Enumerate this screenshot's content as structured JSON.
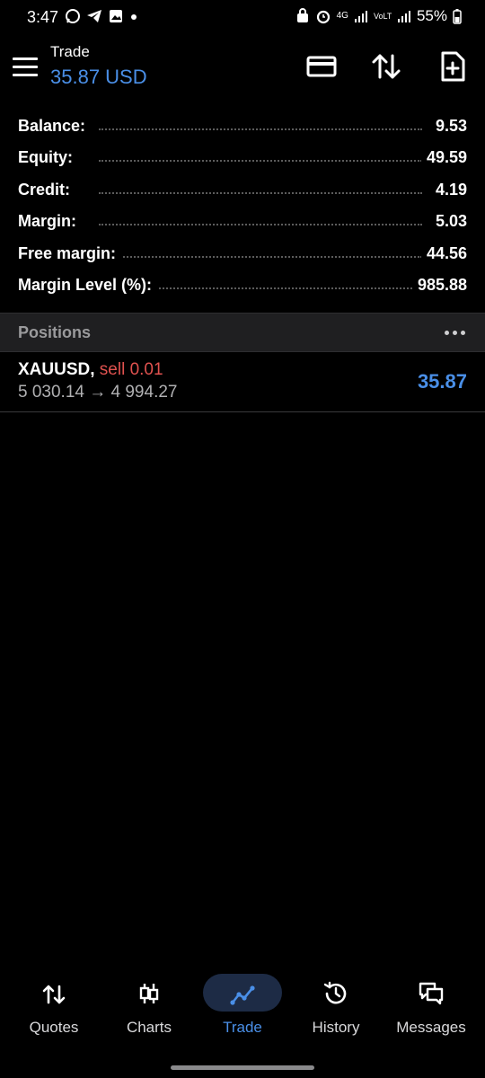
{
  "status_bar": {
    "time": "3:47",
    "battery": "55%",
    "net_label": "4G",
    "volte_label": "VoLTE2"
  },
  "header": {
    "title": "Trade",
    "subtitle": "35.87 USD"
  },
  "summary": [
    {
      "label": "Balance:",
      "value": "9.53"
    },
    {
      "label": "Equity:",
      "value": "49.59"
    },
    {
      "label": "Credit:",
      "value": "4.19"
    },
    {
      "label": "Margin:",
      "value": "5.03"
    },
    {
      "label": "Free margin:",
      "value": "44.56"
    },
    {
      "label": "Margin Level (%):",
      "value": "985.88"
    }
  ],
  "positions": {
    "title": "Positions",
    "items": [
      {
        "symbol": "XAUUSD,",
        "side": "sell 0.01",
        "prices": "5 030.14 → 4 994.27",
        "profit": "35.87"
      }
    ]
  },
  "nav": {
    "items": [
      {
        "label": "Quotes",
        "icon": "quotes-icon"
      },
      {
        "label": "Charts",
        "icon": "charts-icon"
      },
      {
        "label": "Trade",
        "icon": "trade-icon"
      },
      {
        "label": "History",
        "icon": "history-icon"
      },
      {
        "label": "Messages",
        "icon": "messages-icon"
      }
    ],
    "active": "Trade"
  },
  "colors": {
    "accent": "#4a8fe7",
    "sell": "#e0524f",
    "background": "#000000"
  }
}
